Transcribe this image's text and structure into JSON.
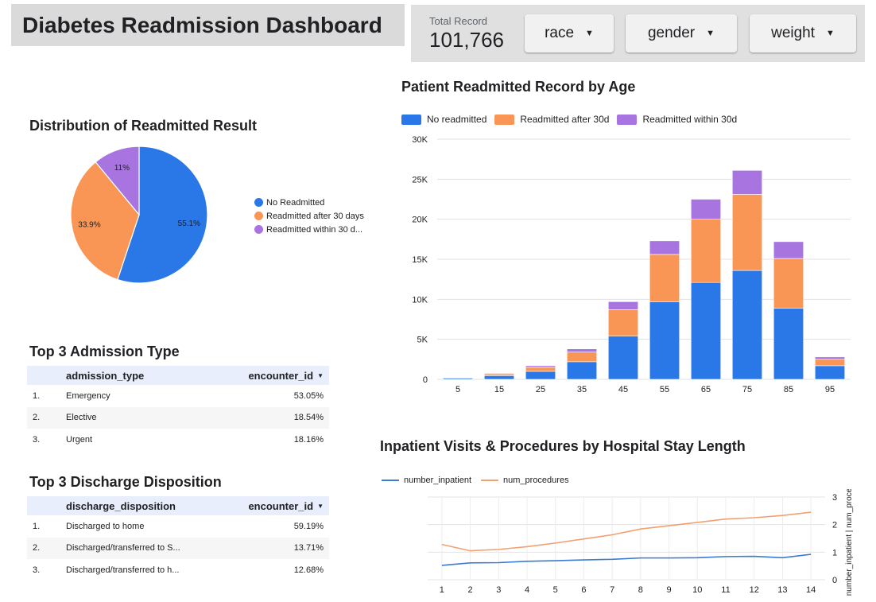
{
  "header": {
    "title": "Diabetes Readmission Dashboard"
  },
  "controls": {
    "total_label": "Total Record",
    "total_value": "101,766",
    "filters": [
      {
        "label": "race"
      },
      {
        "label": "gender"
      },
      {
        "label": "weight"
      }
    ],
    "dropdown_icon": "caret-down-icon"
  },
  "pie": {
    "title": "Distribution of Readmitted Result",
    "legend": [
      "No Readmitted",
      "Readmitted after 30 days",
      "Readmitted within 30 d..."
    ]
  },
  "admission_table": {
    "title": "Top 3 Admission Type",
    "columns": [
      "admission_type",
      "encounter_id"
    ],
    "rows": [
      {
        "idx": "1.",
        "name": "Emergency",
        "value": "53.05%"
      },
      {
        "idx": "2.",
        "name": "Elective",
        "value": "18.54%"
      },
      {
        "idx": "3.",
        "name": "Urgent",
        "value": "18.16%"
      }
    ]
  },
  "discharge_table": {
    "title": "Top 3 Discharge Disposition",
    "columns": [
      "discharge_disposition",
      "encounter_id"
    ],
    "rows": [
      {
        "idx": "1.",
        "name": "Discharged to home",
        "value": "59.19%"
      },
      {
        "idx": "2.",
        "name": "Discharged/transferred to S...",
        "value": "13.71%"
      },
      {
        "idx": "3.",
        "name": "Discharged/transferred to h...",
        "value": "12.68%"
      }
    ]
  },
  "bar": {
    "title": "Patient Readmitted Record by Age",
    "legend": [
      "No readmitted",
      "Readmitted after 30d",
      "Readmitted within 30d"
    ]
  },
  "line": {
    "title": "Inpatient Visits & Procedures by Hospital Stay Length",
    "legend": [
      "number_inpatient",
      "num_procedures"
    ],
    "right_axis_label": "number_inpatient | num_procedures"
  },
  "colors": {
    "blue": "#2a77e8",
    "orange": "#fa9655",
    "purple": "#a875e0",
    "line_blue": "#3b7bd0",
    "line_orange": "#f2a070"
  },
  "chart_data": [
    {
      "type": "pie",
      "title": "Distribution of Readmitted Result",
      "labels": [
        "No Readmitted",
        "Readmitted after 30 days",
        "Readmitted within 30 d..."
      ],
      "values": [
        55.1,
        33.9,
        11.0
      ],
      "value_labels": [
        "55.1%",
        "33.9%",
        "11%"
      ],
      "colors": [
        "#2a77e8",
        "#fa9655",
        "#a875e0"
      ],
      "legend": "right"
    },
    {
      "type": "bar",
      "stacked": true,
      "title": "Patient Readmitted Record by Age",
      "categories": [
        "5",
        "15",
        "25",
        "35",
        "45",
        "55",
        "65",
        "75",
        "85",
        "95"
      ],
      "series": [
        {
          "name": "No readmitted",
          "color": "#2a77e8",
          "values": [
            160,
            460,
            1000,
            2200,
            5400,
            9700,
            12100,
            13600,
            8900,
            1700
          ]
        },
        {
          "name": "Readmitted after 30d",
          "color": "#fa9655",
          "values": [
            30,
            220,
            500,
            1200,
            3300,
            5900,
            7900,
            9500,
            6200,
            800
          ]
        },
        {
          "name": "Readmitted within 30d",
          "color": "#a875e0",
          "values": [
            10,
            80,
            200,
            400,
            1000,
            1700,
            2500,
            3000,
            2100,
            300
          ]
        }
      ],
      "ylim": [
        0,
        30000
      ],
      "yticks": [
        "0",
        "5K",
        "10K",
        "15K",
        "20K",
        "25K",
        "30K"
      ],
      "grid": true,
      "legend": "top"
    },
    {
      "type": "line",
      "title": "Inpatient Visits & Procedures by Hospital Stay Length",
      "x": [
        1,
        2,
        3,
        4,
        5,
        6,
        7,
        8,
        9,
        10,
        11,
        12,
        13,
        14
      ],
      "series": [
        {
          "name": "number_inpatient",
          "color": "#3b7bd0",
          "values": [
            0.52,
            0.61,
            0.62,
            0.67,
            0.69,
            0.72,
            0.74,
            0.79,
            0.79,
            0.8,
            0.84,
            0.85,
            0.8,
            0.92
          ]
        },
        {
          "name": "num_procedures",
          "color": "#f2a070",
          "values": [
            1.28,
            1.05,
            1.1,
            1.2,
            1.33,
            1.48,
            1.63,
            1.84,
            1.96,
            2.08,
            2.2,
            2.25,
            2.33,
            2.45
          ]
        }
      ],
      "ylim": [
        0,
        3
      ],
      "yticks": [
        "0",
        "1",
        "2",
        "3"
      ],
      "y_axis": "right",
      "ylabel": "number_inpatient | num_procedures",
      "grid": true,
      "legend": "top-left"
    }
  ]
}
